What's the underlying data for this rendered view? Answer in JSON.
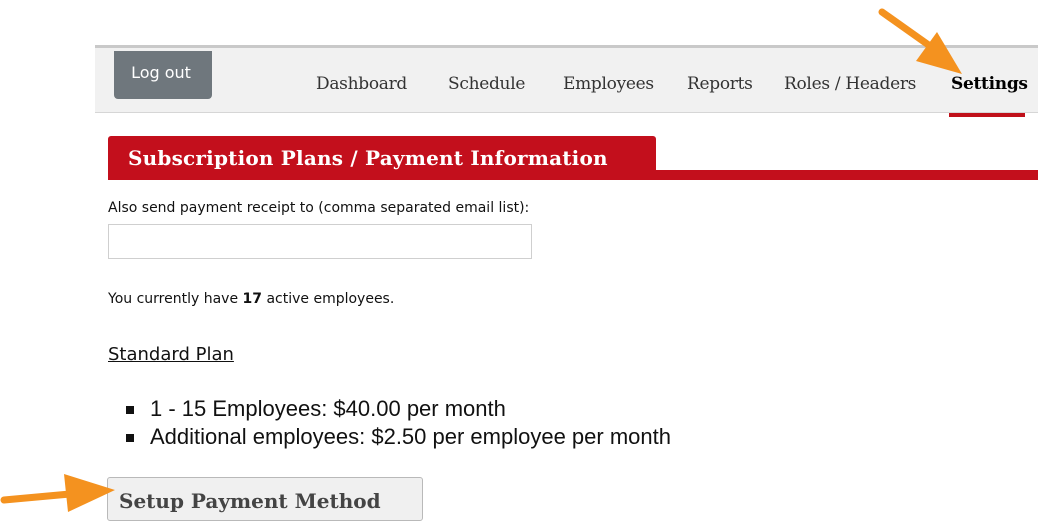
{
  "nav": {
    "logout_label": "Log out",
    "items": [
      {
        "label": "Dashboard"
      },
      {
        "label": "Schedule"
      },
      {
        "label": "Employees"
      },
      {
        "label": "Reports"
      },
      {
        "label": "Roles / Headers"
      },
      {
        "label": "Settings",
        "active": true
      }
    ]
  },
  "section": {
    "title": "Subscription Plans / Payment Information"
  },
  "receipt": {
    "label": "Also send payment receipt to (comma separated email list):",
    "value": "",
    "placeholder": ""
  },
  "employees": {
    "prefix": "You currently have ",
    "count": "17",
    "suffix": " active employees."
  },
  "plan": {
    "title": "Standard Plan",
    "features": [
      "1 - 15 Employees: $40.00 per month",
      "Additional employees: $2.50 per employee per month"
    ]
  },
  "actions": {
    "setup_payment_label": "Setup Payment Method"
  },
  "colors": {
    "brand_red": "#c30f1c",
    "annotation_orange": "#f4921f",
    "logout_gray": "#6f777d"
  },
  "icons": {
    "annotation_arrows": [
      "arrow-pointing-to-settings",
      "arrow-pointing-to-setup-payment"
    ]
  }
}
